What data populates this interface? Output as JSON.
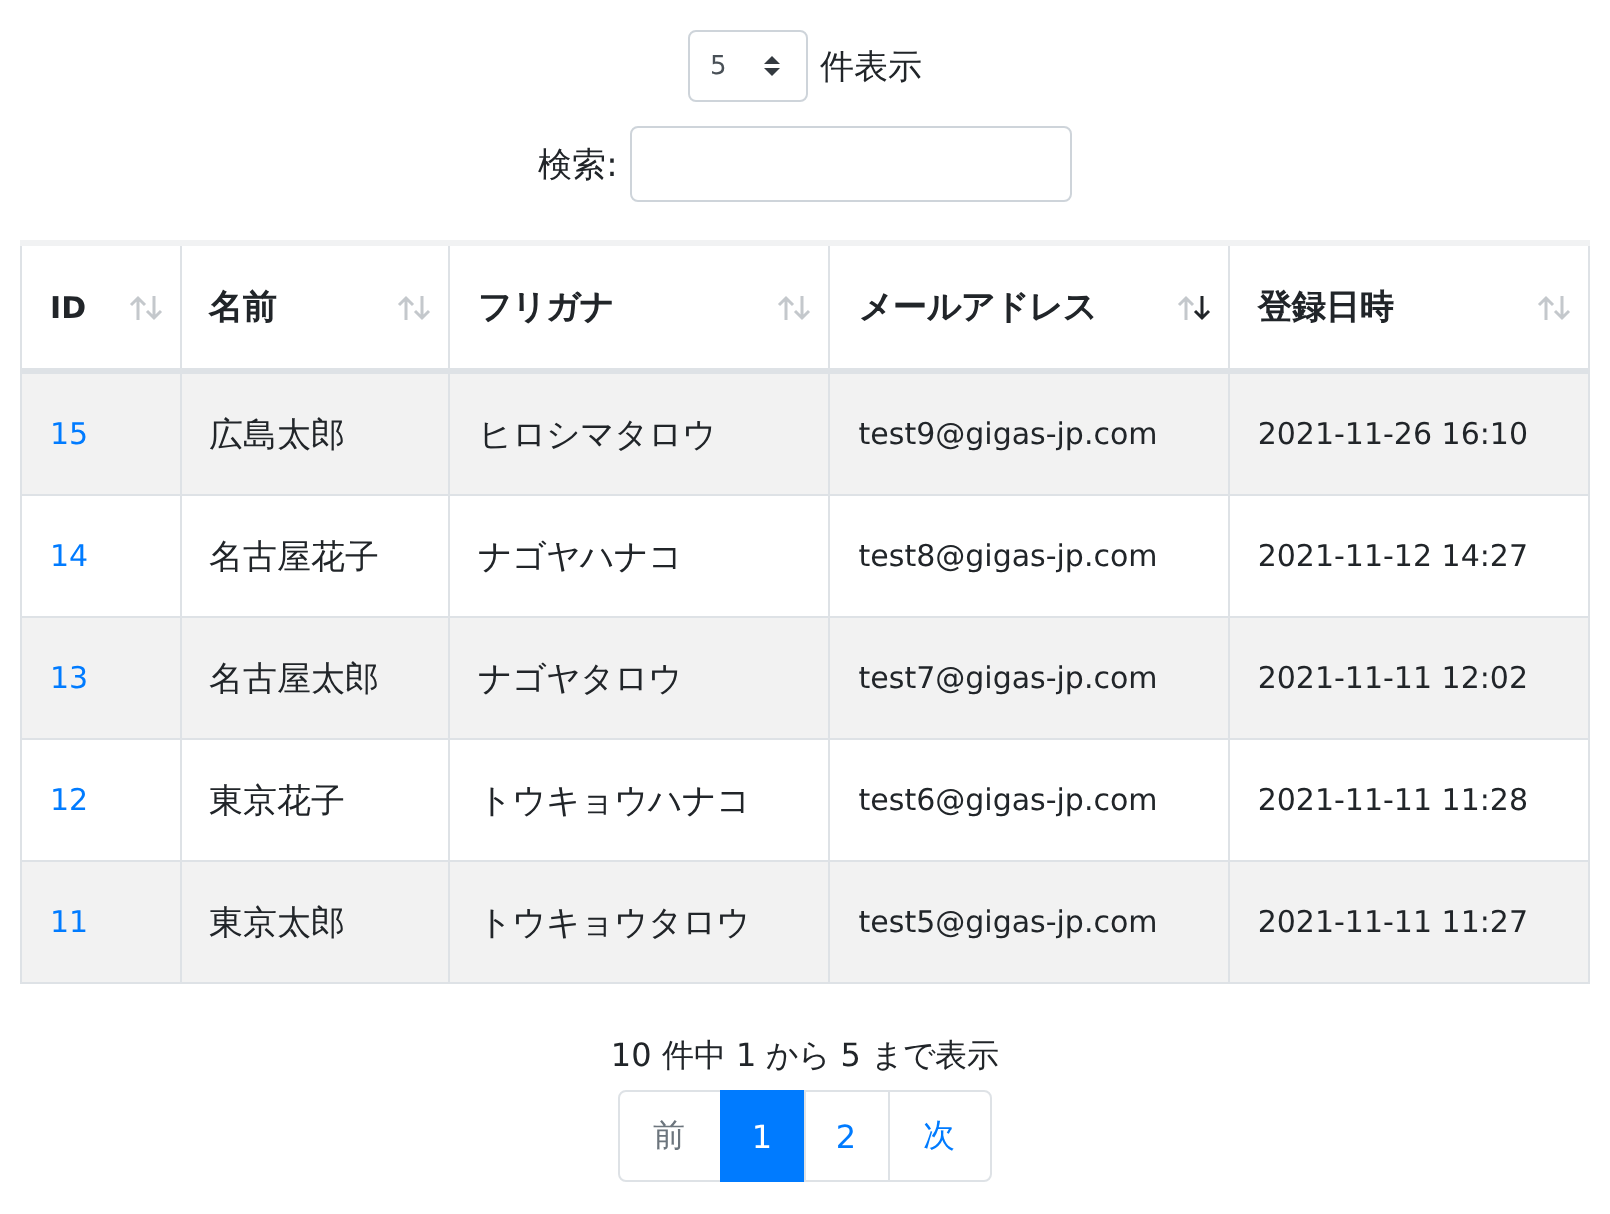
{
  "length_control": {
    "value": "5",
    "label": "件表示"
  },
  "search": {
    "label": "検索:"
  },
  "table": {
    "columns": [
      {
        "label": "ID",
        "sorted": false
      },
      {
        "label": "名前",
        "sorted": false
      },
      {
        "label": "フリガナ",
        "sorted": false
      },
      {
        "label": "メールアドレス",
        "sorted": true
      },
      {
        "label": "登録日時",
        "sorted": false
      }
    ],
    "rows": [
      [
        "15",
        "広島太郎",
        "ヒロシマタロウ",
        "test9@gigas-jp.com",
        "2021-11-26 16:10"
      ],
      [
        "14",
        "名古屋花子",
        "ナゴヤハナコ",
        "test8@gigas-jp.com",
        "2021-11-12 14:27"
      ],
      [
        "13",
        "名古屋太郎",
        "ナゴヤタロウ",
        "test7@gigas-jp.com",
        "2021-11-11 12:02"
      ],
      [
        "12",
        "東京花子",
        "トウキョウハナコ",
        "test6@gigas-jp.com",
        "2021-11-11 11:28"
      ],
      [
        "11",
        "東京太郎",
        "トウキョウタロウ",
        "test5@gigas-jp.com",
        "2021-11-11 11:27"
      ]
    ]
  },
  "info": "10 件中 1 から 5 まで表示",
  "pagination": [
    {
      "label": "前",
      "selected": false,
      "disabled": true
    },
    {
      "label": "1",
      "selected": true,
      "disabled": false
    },
    {
      "label": "2",
      "selected": false,
      "disabled": false
    },
    {
      "label": "次",
      "selected": false,
      "disabled": false
    }
  ]
}
